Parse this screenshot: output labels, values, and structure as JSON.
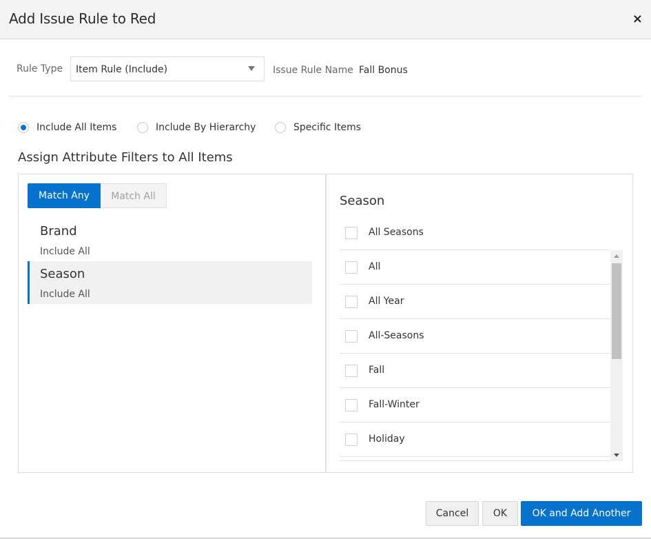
{
  "dialog": {
    "title": "Add Issue Rule to Red",
    "close_icon": "×"
  },
  "form": {
    "rule_type_label": "Rule Type",
    "rule_type_value": "Item Rule (Include)",
    "issue_rule_name_label": "Issue Rule Name",
    "issue_rule_name_value": "Fall Bonus"
  },
  "scope": {
    "options": [
      {
        "label": "Include All Items",
        "selected": true
      },
      {
        "label": "Include By Hierarchy",
        "selected": false
      },
      {
        "label": "Specific Items",
        "selected": false
      }
    ]
  },
  "filters": {
    "section_title": "Assign Attribute Filters to All Items",
    "match": {
      "any_label": "Match Any",
      "all_label": "Match All",
      "selected": "Match Any"
    },
    "attributes": [
      {
        "name": "Brand",
        "status": "Include All",
        "selected": false
      },
      {
        "name": "Season",
        "status": "Include All",
        "selected": true
      }
    ],
    "values_panel": {
      "title": "Season",
      "select_all_label": "All Seasons",
      "options": [
        {
          "label": "All",
          "checked": false
        },
        {
          "label": "All Year",
          "checked": false
        },
        {
          "label": "All-Seasons",
          "checked": false
        },
        {
          "label": "Fall",
          "checked": false
        },
        {
          "label": "Fall-Winter",
          "checked": false
        },
        {
          "label": "Holiday",
          "checked": false
        }
      ]
    }
  },
  "footer": {
    "cancel_label": "Cancel",
    "ok_label": "OK",
    "ok_add_label": "OK and Add Another"
  },
  "colors": {
    "accent": "#0572ce",
    "header_bg": "#f4f4f4"
  }
}
